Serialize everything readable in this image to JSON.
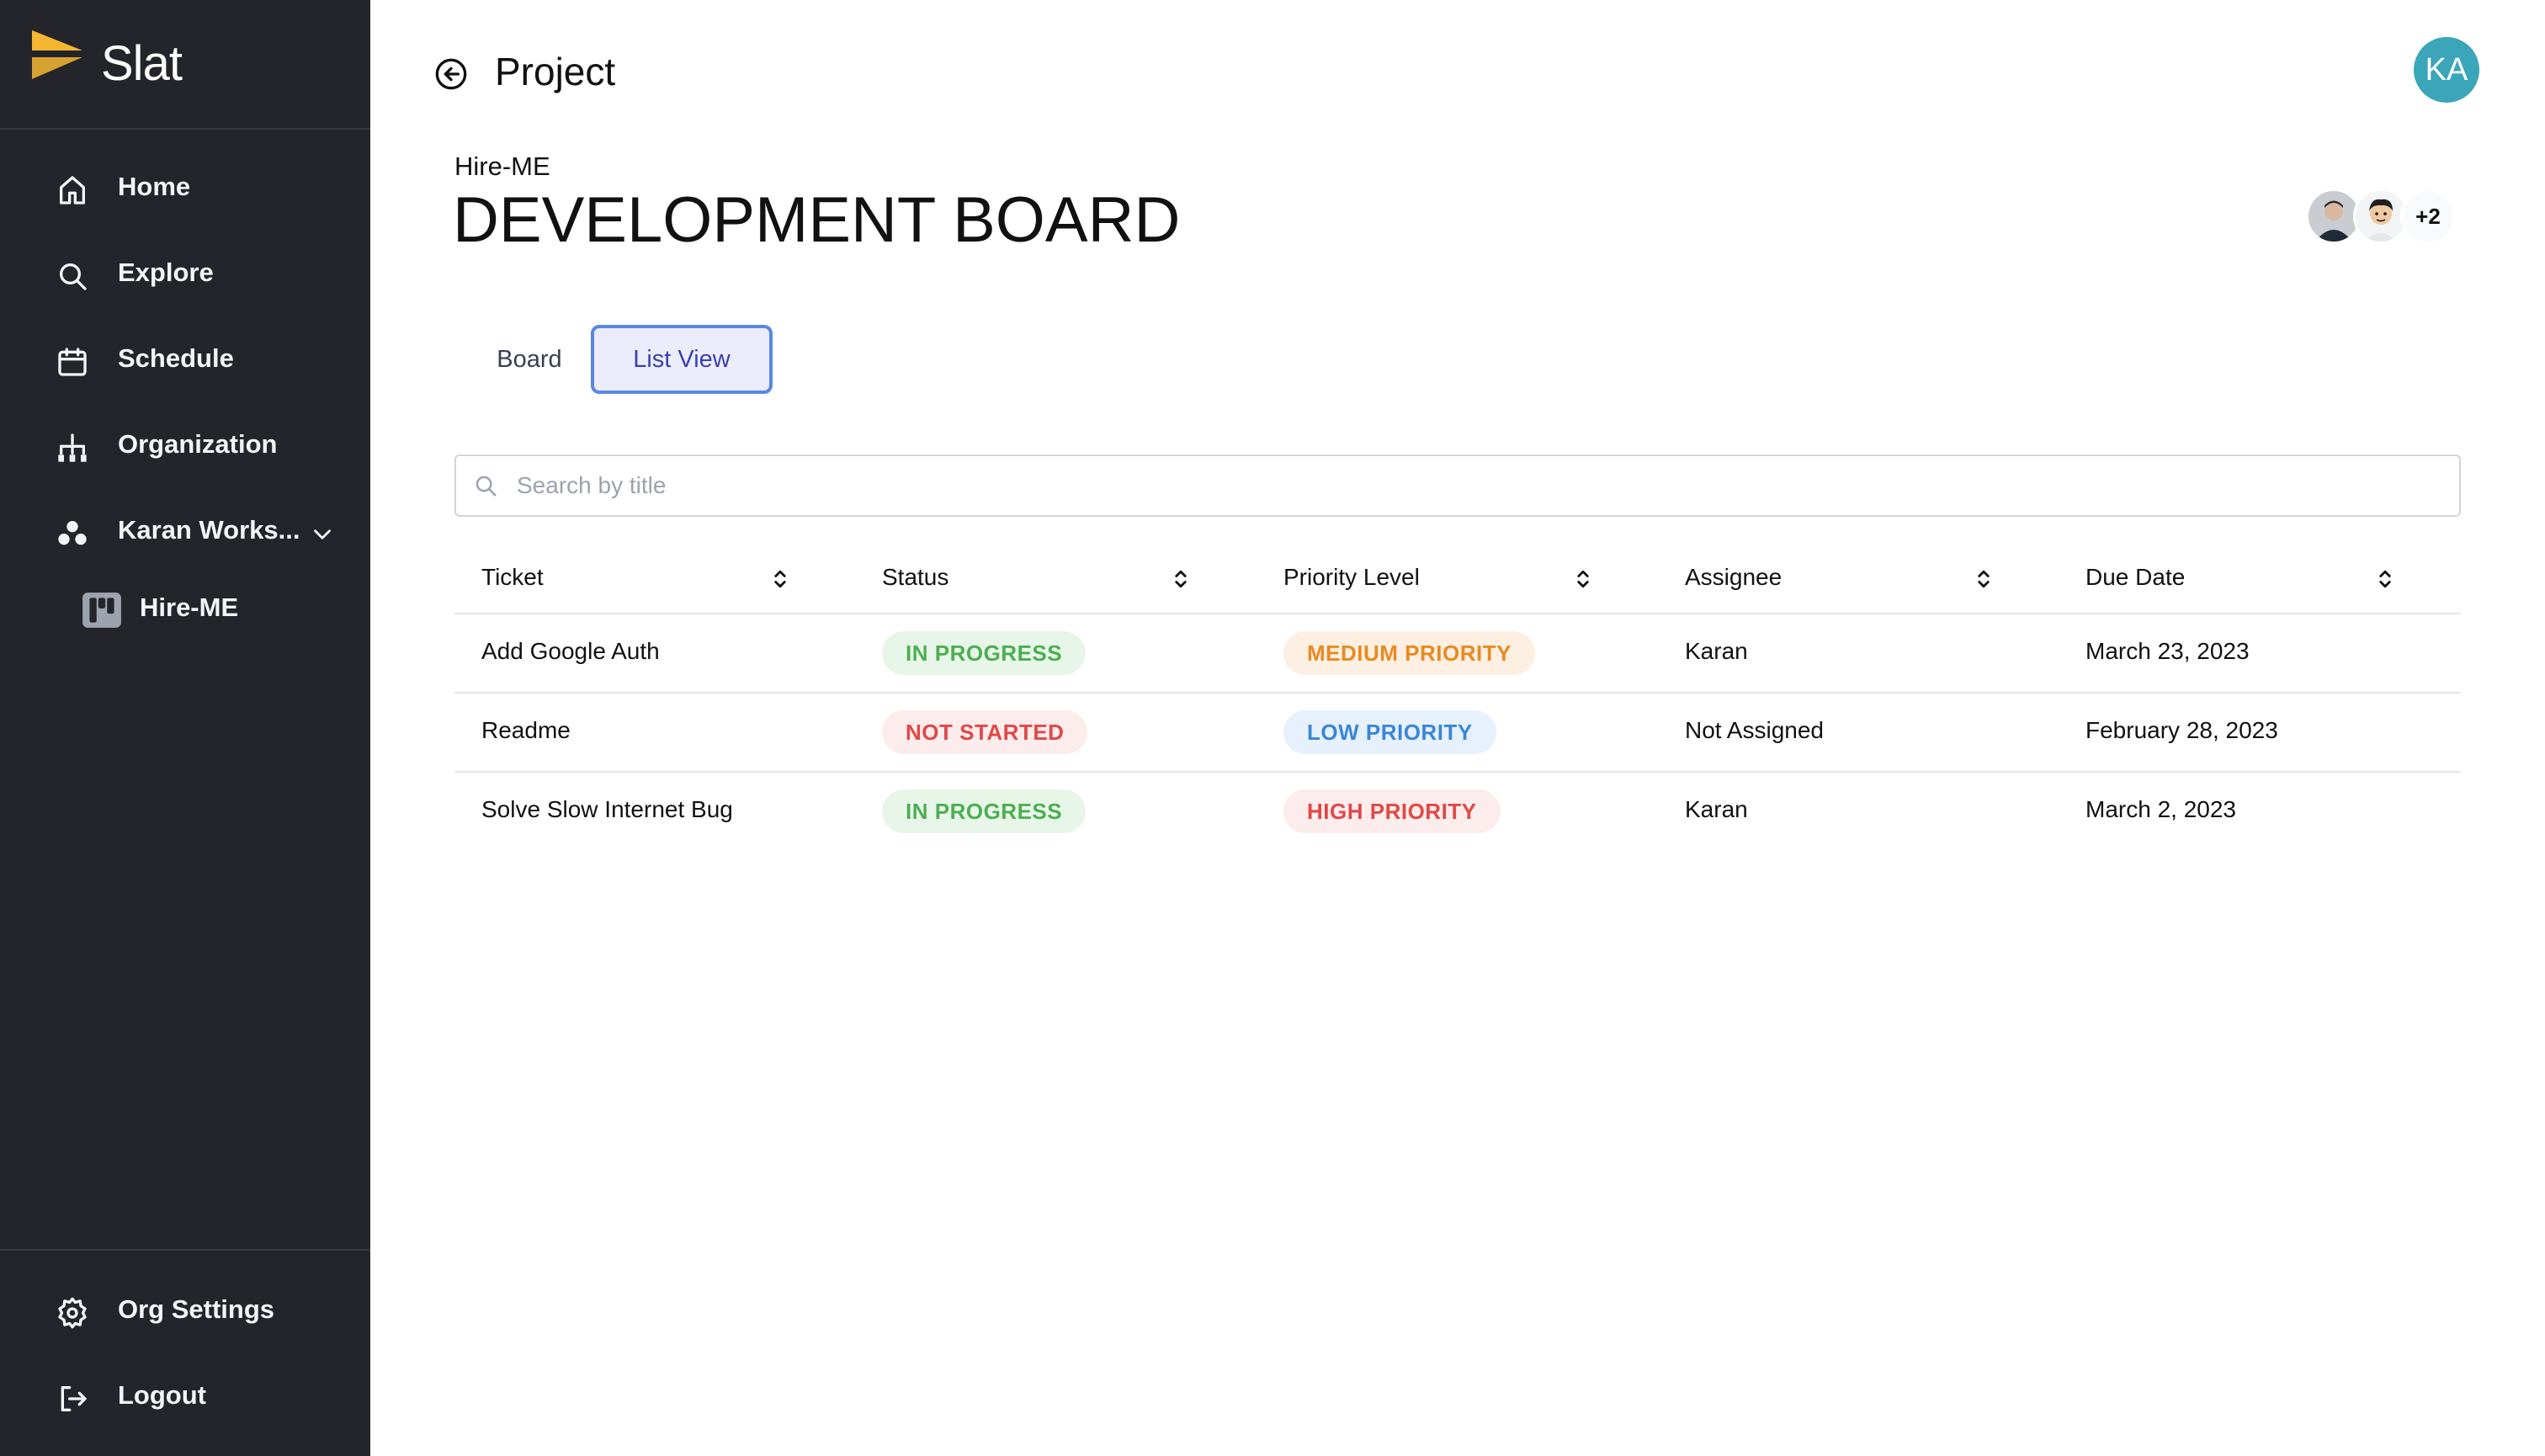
{
  "app": {
    "name": "Slat"
  },
  "sidebar": {
    "items": [
      {
        "label": "Home",
        "icon": "home-icon"
      },
      {
        "label": "Explore",
        "icon": "search-icon"
      },
      {
        "label": "Schedule",
        "icon": "calendar-icon"
      },
      {
        "label": "Organization",
        "icon": "org-chart-icon"
      },
      {
        "label": "Karan Works...",
        "icon": "workspace-icon"
      }
    ],
    "sub_items": [
      {
        "label": "Hire-ME",
        "icon": "board-icon"
      }
    ],
    "bottom": [
      {
        "label": "Org Settings",
        "icon": "gear-icon"
      },
      {
        "label": "Logout",
        "icon": "logout-icon"
      }
    ]
  },
  "header": {
    "title": "Project",
    "user_initials": "KA",
    "avatar_color": "#3ba5b9"
  },
  "project": {
    "name": "Hire-ME",
    "board_title": "DEVELOPMENT BOARD",
    "members_more": "+2"
  },
  "tabs": [
    {
      "label": "Board",
      "active": false
    },
    {
      "label": "List View",
      "active": true
    }
  ],
  "search": {
    "placeholder": "Search by title",
    "value": ""
  },
  "table": {
    "columns": [
      "Ticket",
      "Status",
      "Priority Level",
      "Assignee",
      "Due Date"
    ],
    "rows": [
      {
        "ticket": "Add Google Auth",
        "status": "IN PROGRESS",
        "priority": "MEDIUM PRIORITY",
        "assignee": "Karan",
        "due": "March 23, 2023"
      },
      {
        "ticket": "Readme",
        "status": "NOT STARTED",
        "priority": "LOW PRIORITY",
        "assignee": "Not Assigned",
        "due": "February 28, 2023"
      },
      {
        "ticket": "Solve Slow Internet Bug",
        "status": "IN PROGRESS",
        "priority": "HIGH PRIORITY",
        "assignee": "Karan",
        "due": "March 2, 2023"
      }
    ]
  },
  "colors": {
    "sidebar_bg": "#24252a",
    "accent": "#5a86e6",
    "logo": "#f5b731"
  }
}
